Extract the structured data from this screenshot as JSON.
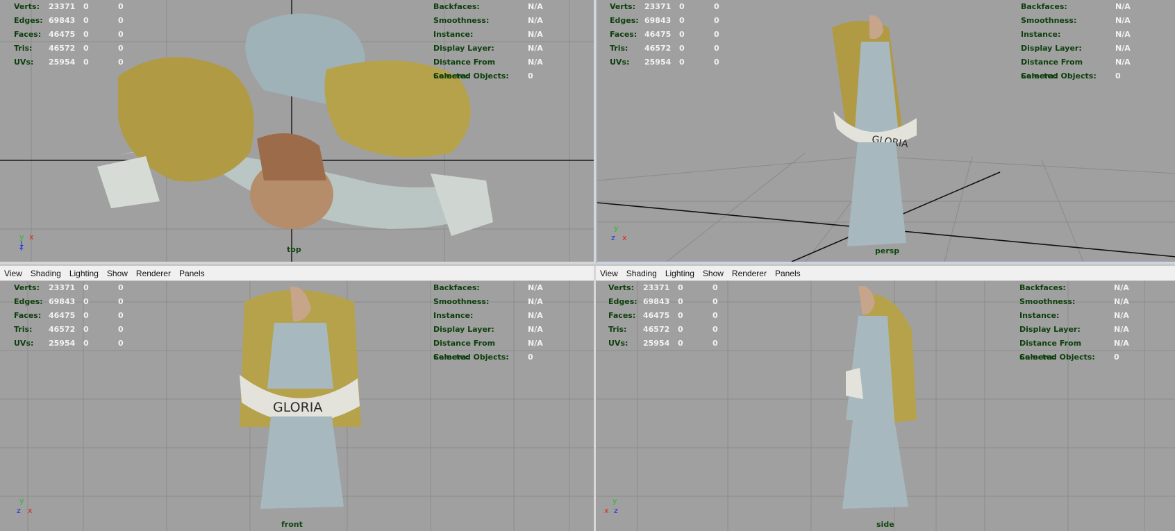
{
  "menu": [
    "View",
    "Shading",
    "Lighting",
    "Show",
    "Renderer",
    "Panels"
  ],
  "hud": {
    "stats": [
      {
        "label": "Verts:",
        "v1": "23371",
        "v2": "0",
        "v3": "0"
      },
      {
        "label": "Edges:",
        "v1": "69843",
        "v2": "0",
        "v3": "0"
      },
      {
        "label": "Faces:",
        "v1": "46475",
        "v2": "0",
        "v3": "0"
      },
      {
        "label": "Tris:",
        "v1": "46572",
        "v2": "0",
        "v3": "0"
      },
      {
        "label": "UVs:",
        "v1": "25954",
        "v2": "0",
        "v3": "0"
      }
    ],
    "info": [
      {
        "label": "Backfaces:",
        "value": "N/A"
      },
      {
        "label": "Smoothness:",
        "value": "N/A"
      },
      {
        "label": "Instance:",
        "value": "N/A"
      },
      {
        "label": "Display Layer:",
        "value": "N/A"
      },
      {
        "label": "Distance From Camera:",
        "value": "N/A"
      },
      {
        "label": "Selected Objects:",
        "value": "0"
      }
    ]
  },
  "viewports": {
    "top": "top",
    "persp": "persp",
    "front": "front",
    "side": "side"
  },
  "banner_text": "GLORIA",
  "axis": {
    "y": "y",
    "z": "z",
    "x": "x"
  },
  "colors": {
    "viewport_bg": "#a0a0a0",
    "hud_label": "#0d3f0d",
    "hud_value": "#f2f2f2",
    "wing": "#b5a24a",
    "robe": "#a7b9be"
  }
}
